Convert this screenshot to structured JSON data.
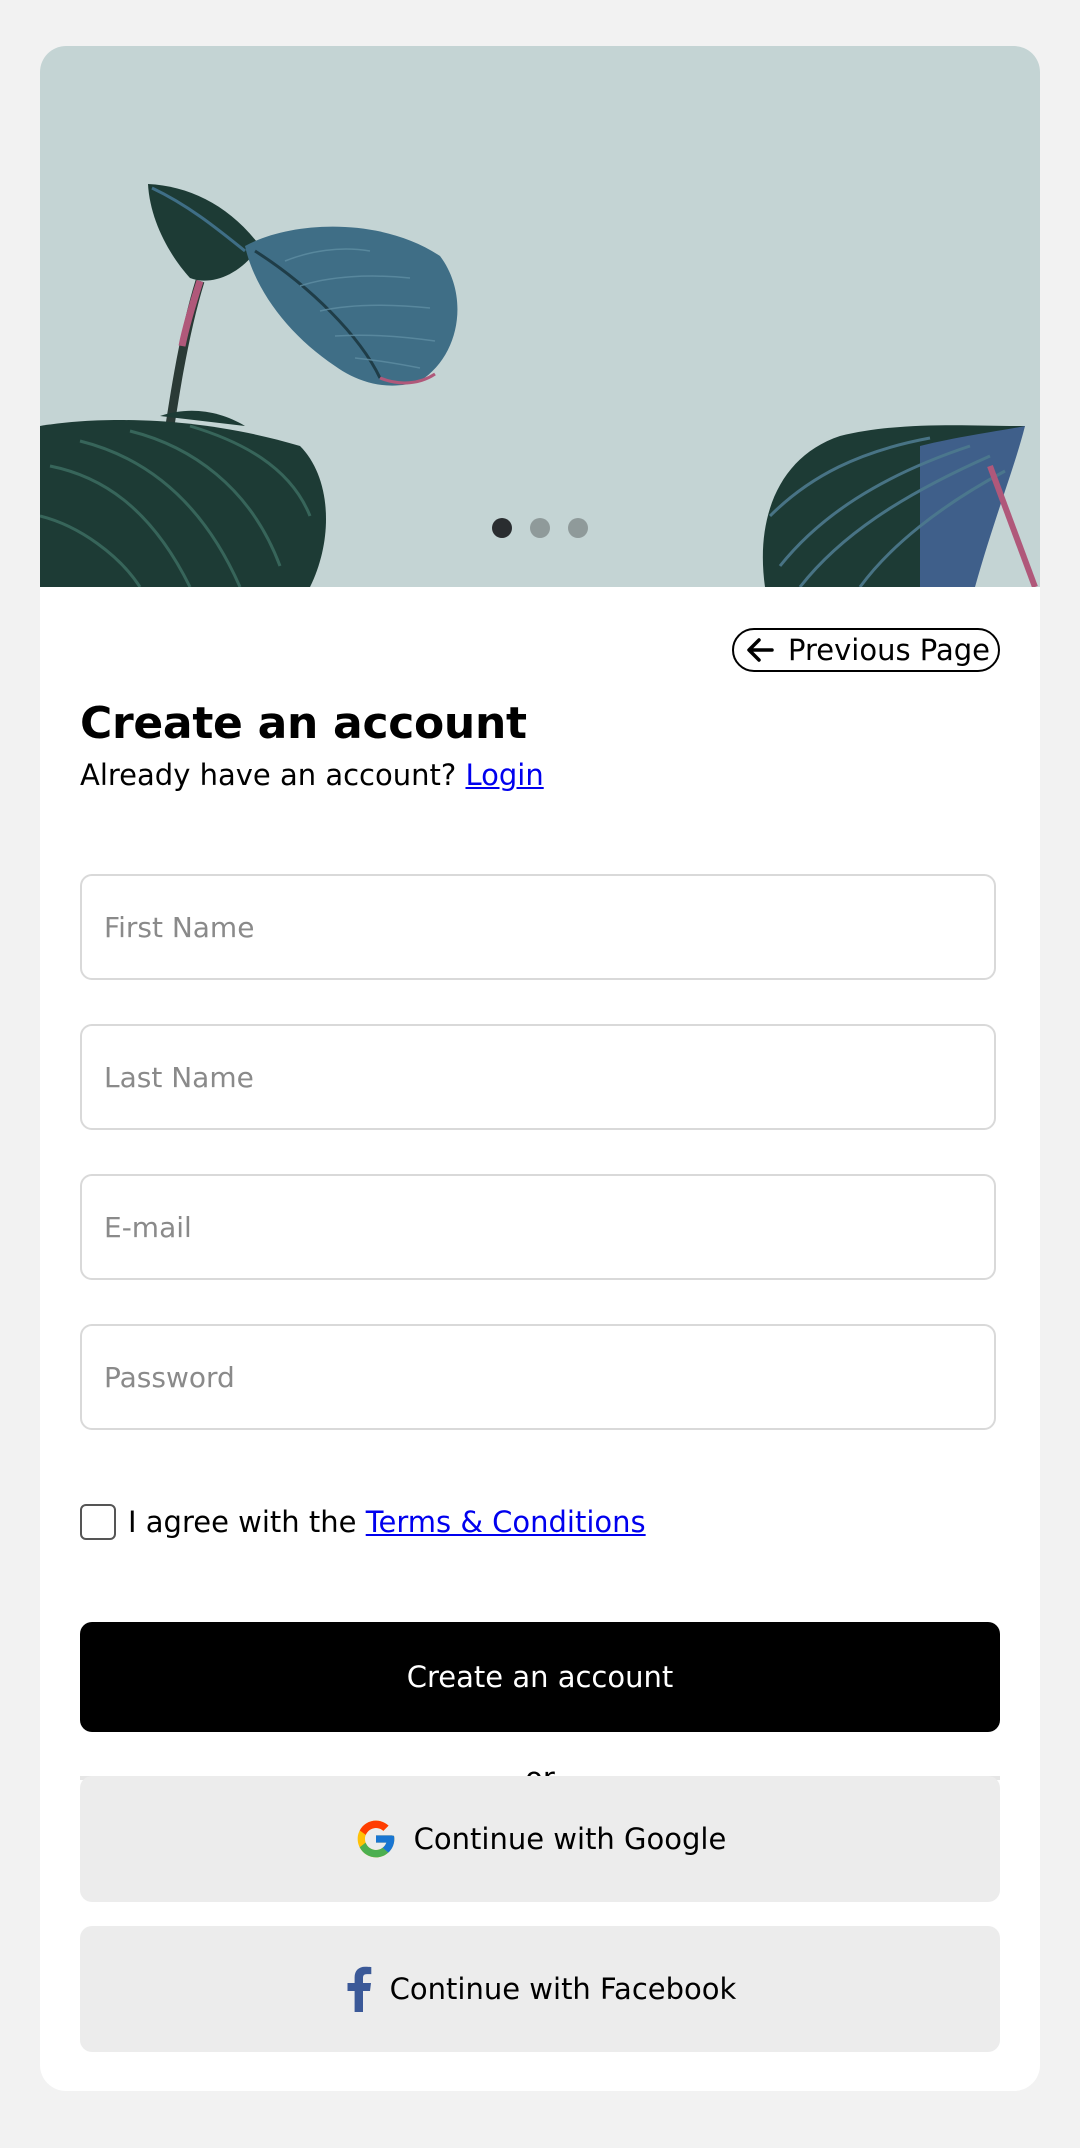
{
  "hero": {
    "carousel": {
      "slide_count": 3,
      "active_index": 0
    },
    "colors": {
      "background": "#c4d4d4",
      "leaf_dark": "#1d3b35",
      "leaf_blue": "#3f6e86",
      "stem": "#b0587a"
    }
  },
  "nav": {
    "previous_page_label": "Previous Page",
    "previous_page_icon": "arrow-left-icon"
  },
  "header": {
    "title": "Create an account",
    "subtitle_prefix": "Already have an account?",
    "login_link": "Login"
  },
  "form": {
    "first_name": {
      "placeholder": "First Name",
      "value": ""
    },
    "last_name": {
      "placeholder": "Last Name",
      "value": ""
    },
    "email": {
      "placeholder": "E-mail",
      "value": ""
    },
    "password": {
      "placeholder": "Password",
      "value": ""
    },
    "agree_prefix": "I agree with the",
    "terms_link": "Terms & Conditions",
    "agree_checked": false,
    "submit_label": "Create an account"
  },
  "divider": {
    "label": "or"
  },
  "social": {
    "google_label": "Continue with Google",
    "google_icon": "google-icon",
    "facebook_label": "Continue with Facebook",
    "facebook_icon": "facebook-icon"
  },
  "colors": {
    "page_background": "#f2f2f2",
    "primary_button": "#000000",
    "social_button": "#ececec",
    "link": "#0000ee",
    "facebook_blue": "#3b5998"
  }
}
